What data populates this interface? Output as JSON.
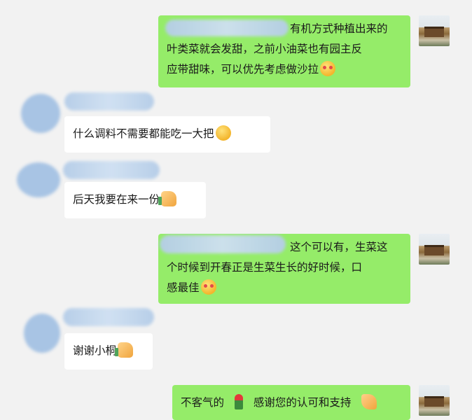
{
  "messages": [
    {
      "side": "right",
      "lines": [
        "有机方式种植出来的",
        "叶类菜就会发甜，之前小油菜也有园主反",
        "应带甜味，可以优先考虑做沙拉"
      ],
      "emoji": "thinking-face"
    },
    {
      "side": "left",
      "lines": [
        "什么调料不需要都能吃一大把"
      ],
      "emoji": "rolling-laughing-face"
    },
    {
      "side": "left",
      "lines": [
        "后天我要在来一份"
      ],
      "emoji": "thumbs-up"
    },
    {
      "side": "right",
      "lines": [
        "这个可以有，生菜这",
        "个时候到开春正是生菜生长的好时候，口",
        "感最佳"
      ],
      "emoji": "heart-eyes-face"
    },
    {
      "side": "left",
      "lines": [
        "谢谢小桐"
      ],
      "emoji": "thumbs-up"
    },
    {
      "side": "right",
      "lines": [
        "不客气的",
        "感谢您的认可和支持"
      ],
      "emoji": "rose"
    }
  ],
  "colors": {
    "my_bubble": "#95ec69",
    "peer_bubble": "#ffffff",
    "background": "#f2f2f2"
  }
}
